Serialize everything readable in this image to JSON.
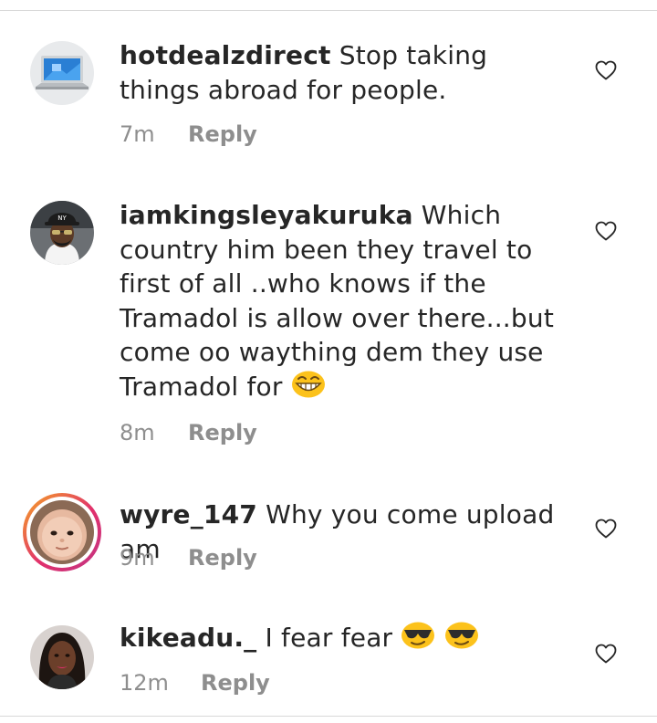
{
  "comments": [
    {
      "username": "hotdealzdirect",
      "text": "Stop taking things abroad for people.",
      "time": "7m",
      "reply_label": "Reply",
      "avatar_icon": "laptop-avatar"
    },
    {
      "username": "iamkingsleyakuruka",
      "text": "Which country him been they travel to first of all ..who knows if the Tramadol is allow over there...but come oo waything dem they use Tramadol for",
      "emoji": "grinning-face-emoji",
      "time": "8m",
      "reply_label": "Reply",
      "avatar_icon": "man-cap-avatar"
    },
    {
      "username": "wyre_147",
      "text": "Why you come upload am",
      "time": "9m",
      "reply_label": "Reply",
      "avatar_icon": "baby-avatar",
      "has_story_ring": true
    },
    {
      "username": "kikeadu._",
      "text": "I fear fear",
      "emoji": "sunglasses-face-emoji x2",
      "time": "12m",
      "reply_label": "Reply",
      "avatar_icon": "woman-avatar"
    }
  ],
  "colors": {
    "text": "#262626",
    "meta": "#8e8e8e",
    "story_ring_start": "#f5a623",
    "story_ring_end": "#c13584"
  }
}
